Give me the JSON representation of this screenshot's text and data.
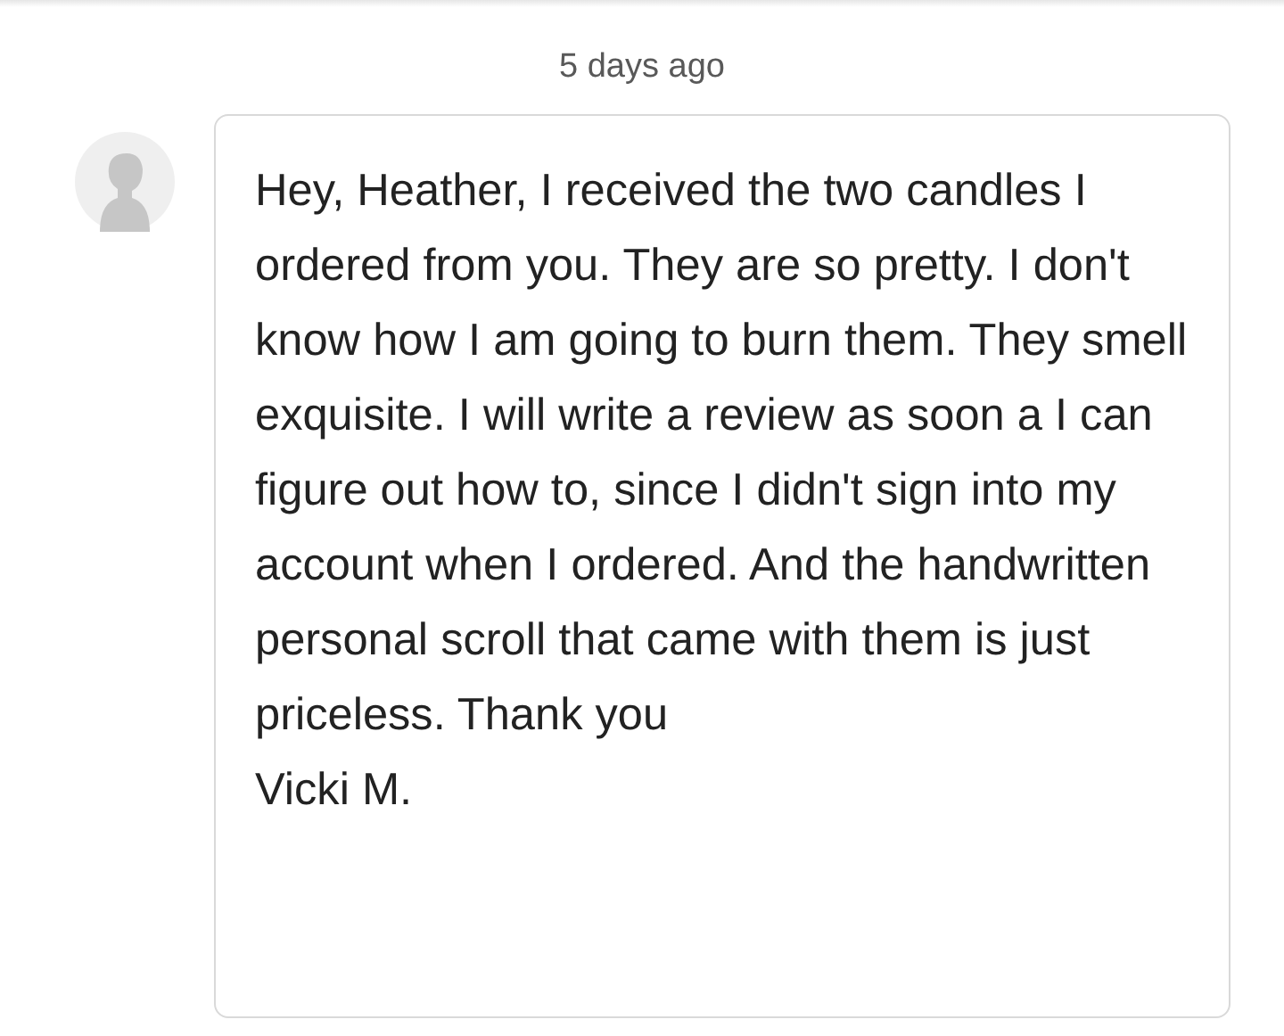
{
  "timestamp": "5 days ago",
  "message": {
    "sender_avatar": {
      "kind": "avatar"
    },
    "body": "Hey, Heather, I received the two candles I ordered from you. They are so pretty. I don't know how I am going to burn them. They smell exquisite. I will write a review as soon a I can figure out how to, since I didn't sign into my account when I ordered. And the handwritten personal scroll that came with them is just priceless. Thank you",
    "signature": "Vicki M."
  }
}
